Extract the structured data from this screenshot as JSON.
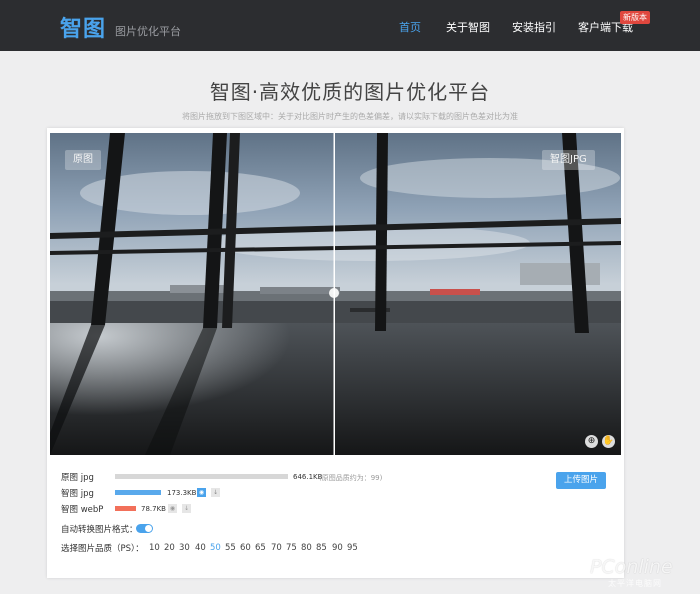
{
  "header": {
    "logo": "智图",
    "logo_sub": "图片优化平台",
    "nav": [
      "首页",
      "关于智图",
      "安装指引",
      "客户端下载"
    ],
    "badge": "新版本"
  },
  "main": {
    "title": "智图·高效优质的图片优化平台",
    "subtitle": "将图片拖放到下图区域中：关于对比图片时产生的色差偏差，请以实际下载的图片色差对比为准"
  },
  "viewer": {
    "left_label": "原图",
    "right_label": "智图JPG"
  },
  "stats": {
    "rows": [
      {
        "label": "原图 jpg",
        "size": "646.1KB",
        "note": "(原图品质约为：99)",
        "fill": 1.0,
        "color": "#d7d7d7"
      },
      {
        "label": "智图 jpg",
        "size": "173.3KB",
        "fill": 0.268,
        "color": "#59a9ec"
      },
      {
        "label": "智图 webP",
        "size": "78.7KB",
        "fill": 0.122,
        "color": "#f2705a"
      }
    ],
    "upload_label": "上传图片",
    "auto_convert_label": "自动转换图片格式：",
    "auto_convert_on": true,
    "quality_label": "选择图片品质（PS）：",
    "quality_options": [
      "10",
      "20",
      "30",
      "40",
      "50",
      "55",
      "60",
      "65",
      "70",
      "75",
      "80",
      "85",
      "90",
      "95"
    ],
    "quality_selected": "50"
  },
  "watermark": {
    "brand": "PConline",
    "sub": "太平洋电脑网"
  },
  "colors": {
    "accent": "#4aa3ec",
    "header_bg": "#2c2d30",
    "badge": "#e0473e"
  }
}
